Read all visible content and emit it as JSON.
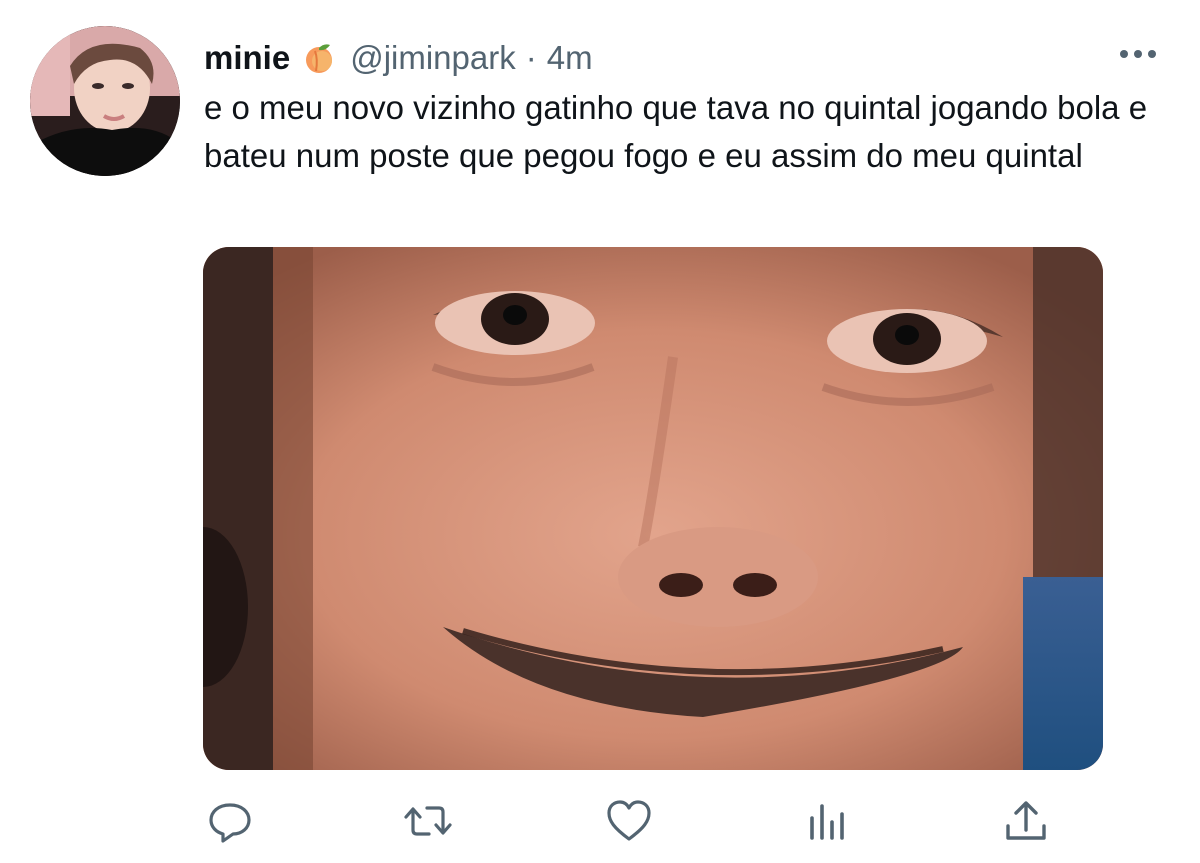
{
  "tweet": {
    "display_name": "minie",
    "name_emoji": "peach-emoji",
    "handle": "@jiminpark",
    "separator": "·",
    "time": "4m",
    "text": "e o meu novo vizinho gatinho que tava no quintal jogando bola e bateu num poste que pegou fogo e eu assim do meu quintal"
  },
  "icons": {
    "more": "more-horizontal-icon",
    "reply": "reply-icon",
    "retweet": "retweet-icon",
    "like": "heart-icon",
    "analytics": "analytics-icon",
    "share": "share-icon"
  },
  "colors": {
    "text_primary": "#0f1419",
    "text_secondary": "#536471",
    "icon": "#536471",
    "background": "#ffffff"
  }
}
